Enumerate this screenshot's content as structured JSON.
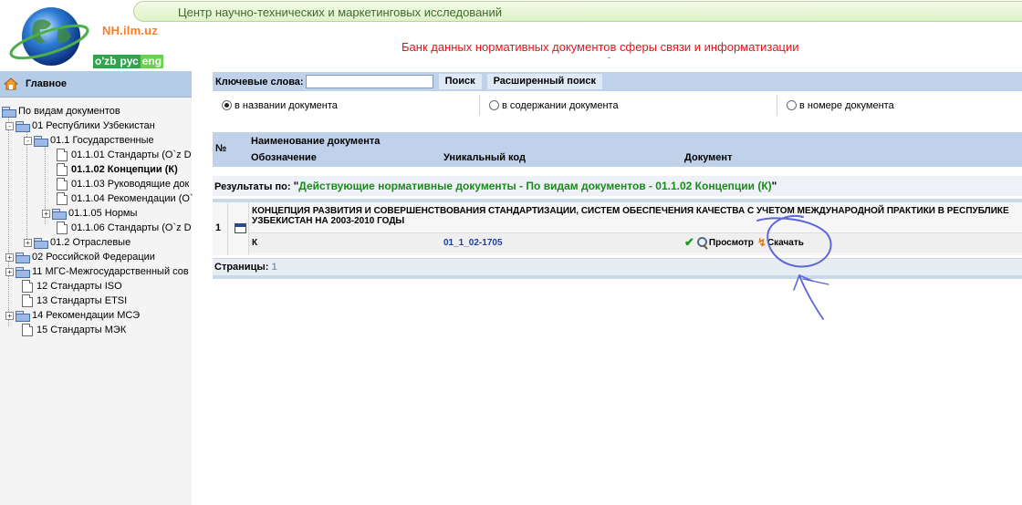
{
  "header": {
    "banner_text": "Центр научно-технических и маркетинговых исследований",
    "site_name": "NH.ilm.uz",
    "languages": [
      {
        "label": "o'zb",
        "active": false
      },
      {
        "label": "рус",
        "active": false
      },
      {
        "label": "eng",
        "active": true
      }
    ],
    "page_title": "Банк данных нормативных документов сферы связи и информатизации",
    "title_suffix": "-"
  },
  "sidebar": {
    "home_label": "Главное",
    "tree": [
      {
        "label": "По видам документов",
        "level": 0,
        "icon": "folder-open",
        "toggle": "",
        "bold": false
      },
      {
        "label": "01 Республики Узбекистан",
        "level": 0,
        "icon": "folder-open",
        "toggle": "-",
        "bold": false
      },
      {
        "label": "01.1 Государственные",
        "level": 1,
        "icon": "folder-open",
        "toggle": "-",
        "bold": false
      },
      {
        "label": "01.1.01 Стандарты (O`z D",
        "level": 2,
        "icon": "document",
        "toggle": "",
        "bold": false
      },
      {
        "label": "01.1.02 Концепции (К)",
        "level": 2,
        "icon": "document",
        "toggle": "",
        "bold": true
      },
      {
        "label": "01.1.03 Руководящие док",
        "level": 2,
        "icon": "document",
        "toggle": "",
        "bold": false
      },
      {
        "label": "01.1.04 Рекомендации (O`",
        "level": 2,
        "icon": "document",
        "toggle": "",
        "bold": false
      },
      {
        "label": "01.1.05 Нормы",
        "level": 2,
        "icon": "folder",
        "toggle": "+",
        "bold": false
      },
      {
        "label": "01.1.06 Стандарты (O`z D",
        "level": 2,
        "icon": "document",
        "toggle": "",
        "bold": false
      },
      {
        "label": "01.2 Отраслевые",
        "level": 1,
        "icon": "folder",
        "toggle": "+",
        "bold": false
      },
      {
        "label": "02 Российской Федерации",
        "level": 0,
        "icon": "folder",
        "toggle": "+",
        "bold": false
      },
      {
        "label": "11 МГС-Межгосударственный сов",
        "level": 0,
        "icon": "folder",
        "toggle": "+",
        "bold": false
      },
      {
        "label": "12 Стандарты ISO",
        "level": 0,
        "icon": "document",
        "toggle": "",
        "bold": false
      },
      {
        "label": "13 Стандарты ETSI",
        "level": 0,
        "icon": "document",
        "toggle": "",
        "bold": false
      },
      {
        "label": "14 Рекомендации МСЭ",
        "level": 0,
        "icon": "folder",
        "toggle": "+",
        "bold": false
      },
      {
        "label": "15 Стандарты МЭК",
        "level": 0,
        "icon": "document",
        "toggle": "",
        "bold": false
      }
    ]
  },
  "search": {
    "keywords_label": "Ключевые слова:",
    "keywords_value": "",
    "search_button": "Поиск",
    "advanced_button": "Расширенный поиск",
    "options": [
      {
        "label": "в названии документа",
        "checked": true
      },
      {
        "label": "в содержании документа",
        "checked": false
      },
      {
        "label": "в номере документа",
        "checked": false
      }
    ]
  },
  "table": {
    "col_num": "№",
    "col_name": "Наименование документа",
    "col_designation": "Обозначение",
    "col_code": "Уникальный код",
    "col_document": "Документ",
    "results_prefix": "Результаты по: ",
    "results_value": "Действующие нормативные документы - По видам документов - 01.1.02 Концепции (К)",
    "rows": [
      {
        "num": "1",
        "title": "КОНЦЕПЦИЯ РАЗВИТИЯ И СОВЕРШЕНСТВОВАНИЯ СТАНДАРТИЗАЦИИ, СИСТЕМ ОБЕСПЕЧЕНИЯ КАЧЕСТВА С УЧЕТОМ МЕЖДУНАРОДНОЙ ПРАКТИКИ В РЕСПУБЛИКЕ УЗБЕКИСТАН НА 2003-2010 ГОДЫ",
        "designation": "К",
        "code": "01_1_02-1705",
        "view_label": "Просмотр",
        "download_label": "Скачать"
      }
    ],
    "pages_label": "Страницы:",
    "pages_value": "1"
  },
  "colors": {
    "accent_blue": "#bfd2ea",
    "title_red": "#e4141b",
    "results_green": "#1a8a1a",
    "site_orange": "#ff7d1e",
    "annotation_pen": "#5e66d8"
  }
}
